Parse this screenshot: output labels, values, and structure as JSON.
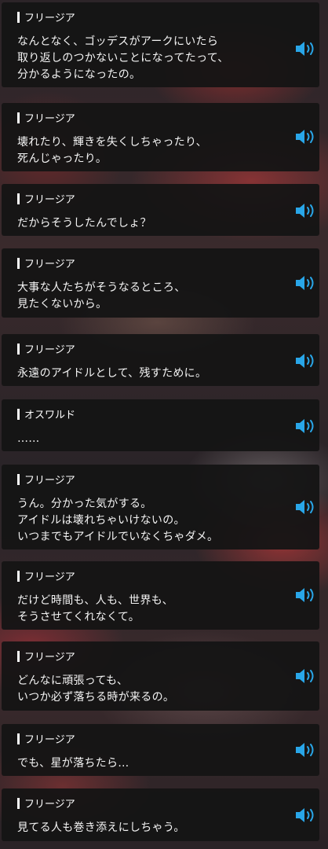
{
  "accent_color": "#29a6e8",
  "voice_icon": "speaker-volume-icon",
  "entries": [
    {
      "speaker": "フリージア",
      "lines": [
        "なんとなく、ゴッデスがアークにいたら",
        "取り返しのつかないことになってたって、",
        "分かるようになったの。"
      ]
    },
    {
      "speaker": "フリージア",
      "lines": [
        "壊れたり、輝きを失くしちゃったり、",
        "死んじゃったり。"
      ]
    },
    {
      "speaker": "フリージア",
      "lines": [
        "だからそうしたんでしょ？"
      ]
    },
    {
      "speaker": "フリージア",
      "lines": [
        "大事な人たちがそうなるところ、",
        "見たくないから。"
      ]
    },
    {
      "speaker": "フリージア",
      "lines": [
        "永遠のアイドルとして、残すために。"
      ]
    },
    {
      "speaker": "オスワルド",
      "lines": [
        "……"
      ]
    },
    {
      "speaker": "フリージア",
      "lines": [
        "うん。分かった気がする。",
        "アイドルは壊れちゃいけないの。",
        "いつまでもアイドルでいなくちゃダメ。"
      ]
    },
    {
      "speaker": "フリージア",
      "lines": [
        "だけど時間も、人も、世界も、",
        "そうさせてくれなくて。"
      ]
    },
    {
      "speaker": "フリージア",
      "lines": [
        "どんなに頑張っても、",
        "いつか必ず落ちる時が来るの。"
      ]
    },
    {
      "speaker": "フリージア",
      "lines": [
        "でも、星が落ちたら…"
      ]
    },
    {
      "speaker": "フリージア",
      "lines": [
        "見てる人も巻き添えにしちゃう。"
      ]
    }
  ]
}
